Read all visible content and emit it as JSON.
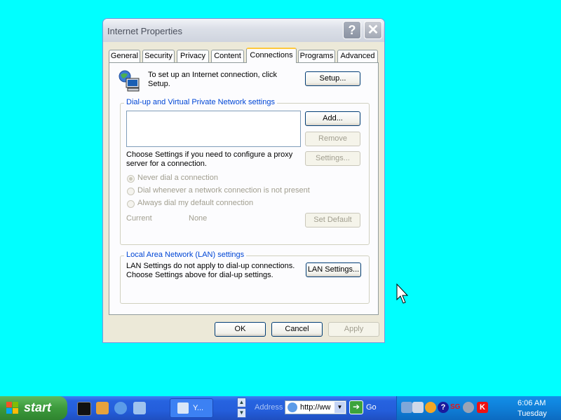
{
  "window": {
    "title": "Internet Properties",
    "help_glyph": "?",
    "close_glyph": "✕"
  },
  "tabs": [
    "General",
    "Security",
    "Privacy",
    "Content",
    "Connections",
    "Programs",
    "Advanced"
  ],
  "active_tab": "Connections",
  "setup": {
    "text_line1": "To set up an Internet connection, click",
    "text_line2": "Setup.",
    "button": "Setup..."
  },
  "dialup": {
    "group_label": "Dial-up and Virtual Private Network settings",
    "add_button": "Add...",
    "remove_button": "Remove",
    "settings_button": "Settings...",
    "proxy_text_line1": "Choose Settings if you need to configure a proxy",
    "proxy_text_line2": "server for a connection.",
    "radio_never": "Never dial a connection",
    "radio_whenever": "Dial whenever a network connection is not present",
    "radio_always": "Always dial my default connection",
    "current_label": "Current",
    "current_value": "None",
    "set_default_button": "Set Default"
  },
  "lan": {
    "group_label": "Local Area Network (LAN) settings",
    "text_line1": "LAN Settings do not apply to dial-up connections.",
    "text_line2": "Choose Settings above for dial-up settings.",
    "button": "LAN Settings..."
  },
  "footer": {
    "ok": "OK",
    "cancel": "Cancel",
    "apply": "Apply"
  },
  "taskbar": {
    "start_label": "start",
    "task_label": "Y...",
    "address_label": "Address",
    "address_value": "http://ww",
    "go_label": "Go",
    "clock_time": "6:06 AM",
    "clock_day": "Tuesday"
  },
  "colors": {
    "desktop": "#00FFFF",
    "group_label": "#0046D5",
    "taskbar": "#245EDB",
    "start_button": "#3C9A3C"
  }
}
